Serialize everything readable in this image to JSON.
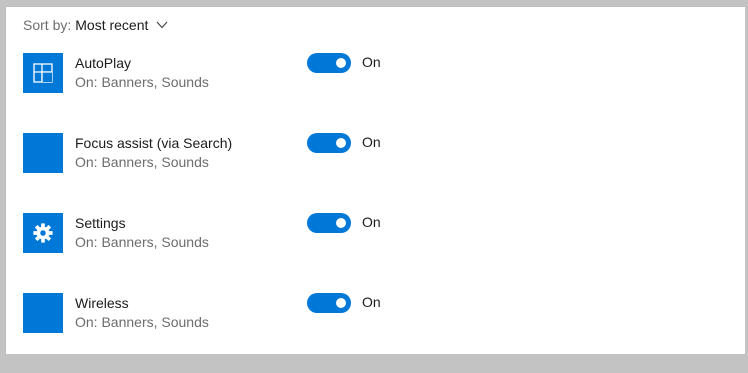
{
  "sort": {
    "label": "Sort by:",
    "value": "Most recent"
  },
  "apps": [
    {
      "name": "AutoPlay",
      "subtitle": "On: Banners, Sounds",
      "toggle_state": "On",
      "enabled": true,
      "icon": "autoplay-icon"
    },
    {
      "name": "Focus assist (via Search)",
      "subtitle": "On: Banners, Sounds",
      "toggle_state": "On",
      "enabled": true,
      "icon": "focus-assist-icon"
    },
    {
      "name": "Settings",
      "subtitle": "On: Banners, Sounds",
      "toggle_state": "On",
      "enabled": true,
      "icon": "gear-icon"
    },
    {
      "name": "Wireless",
      "subtitle": "On: Banners, Sounds",
      "toggle_state": "On",
      "enabled": true,
      "icon": "wireless-icon"
    }
  ],
  "colors": {
    "accent": "#0078d7",
    "frame": "#c3c3c3",
    "text_primary": "#1b1b1b",
    "text_secondary": "#6d6d6d"
  }
}
